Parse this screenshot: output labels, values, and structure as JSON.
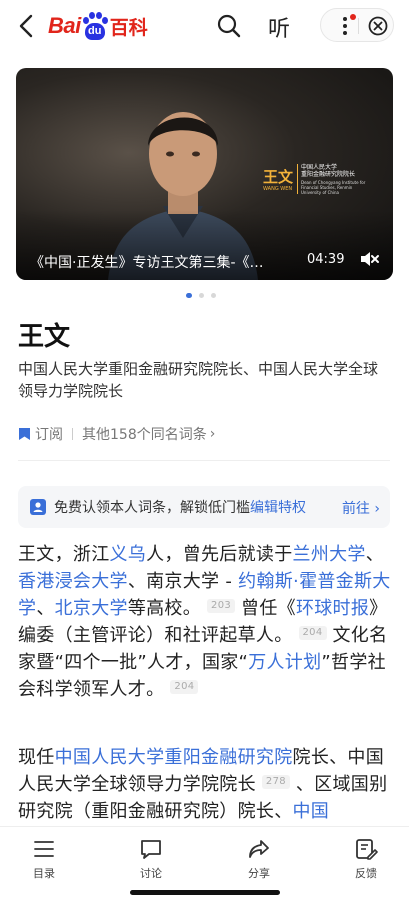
{
  "header": {
    "logo_bai": "Bai",
    "logo_du": "du",
    "logo_baike": "百科",
    "listen_label": "听",
    "icons": [
      "back-arrow-icon",
      "search-icon",
      "more-menu-icon",
      "close-circle-icon"
    ],
    "colors": {
      "brand_red": "#e1251b",
      "brand_blue": "#2932e1"
    }
  },
  "video": {
    "title": "《中国·正发生》专访王文第三集-《…",
    "duration": "04:39",
    "caption_name": "王文",
    "caption_name_en": "WANG WEN",
    "caption_title_line1": "中国人民大学",
    "caption_title_line2": "重阳金融研究院院长",
    "caption_title_en": "Dean of Chongyang Institute for Financial Studies, Renmin University of China"
  },
  "entry": {
    "title": "王文",
    "description": "中国人民大学重阳金融研究院院长、中国人民大学全球领导力学院院长",
    "subscribe_label": "订阅",
    "others_label": "其他158个同名词条",
    "chevron": "›"
  },
  "claim": {
    "text": "免费认领本人词条，解锁低门槛",
    "highlight": "编辑特权",
    "go_label": "前往",
    "go_chevron": "›"
  },
  "paragraph1": {
    "t1": "王文，浙江",
    "l1": "义乌",
    "t2": "人，曾先后就读于",
    "l2": "兰州大学",
    "t3": "、",
    "l3": "香港浸会大学",
    "t4": "、南京大学 - ",
    "l4": "约翰斯·霍普金斯大学",
    "t5": "、",
    "l5": "北京大学",
    "t6": "等高校。",
    "ref1": "203",
    "t7": "曾任《",
    "l6": "环球时报",
    "t8": "》编委（主管评论）和社评起草人。",
    "ref2": "204",
    "t9": "文化名家暨“四个一批”人才，国家“",
    "l7": "万人计划",
    "t10": "”哲学社会科学领军人才。",
    "ref3": "204"
  },
  "paragraph2": {
    "t1": "现任",
    "l1": "中国人民大学重阳金融研究院",
    "t2": "院长、中国人民大学全球领导力学院院长",
    "ref1": "278",
    "t3": "、区域国别研究院（重阳金融研究院）院长、",
    "l2": "中国"
  },
  "bottom_tabs": [
    {
      "label": "目录",
      "icon": "toc-icon"
    },
    {
      "label": "讨论",
      "icon": "chat-bubble-icon"
    },
    {
      "label": "分享",
      "icon": "share-icon"
    },
    {
      "label": "反馈",
      "icon": "feedback-icon"
    }
  ],
  "colors": {
    "link": "#3a6fd8",
    "video_caption": "#f2b23a"
  }
}
